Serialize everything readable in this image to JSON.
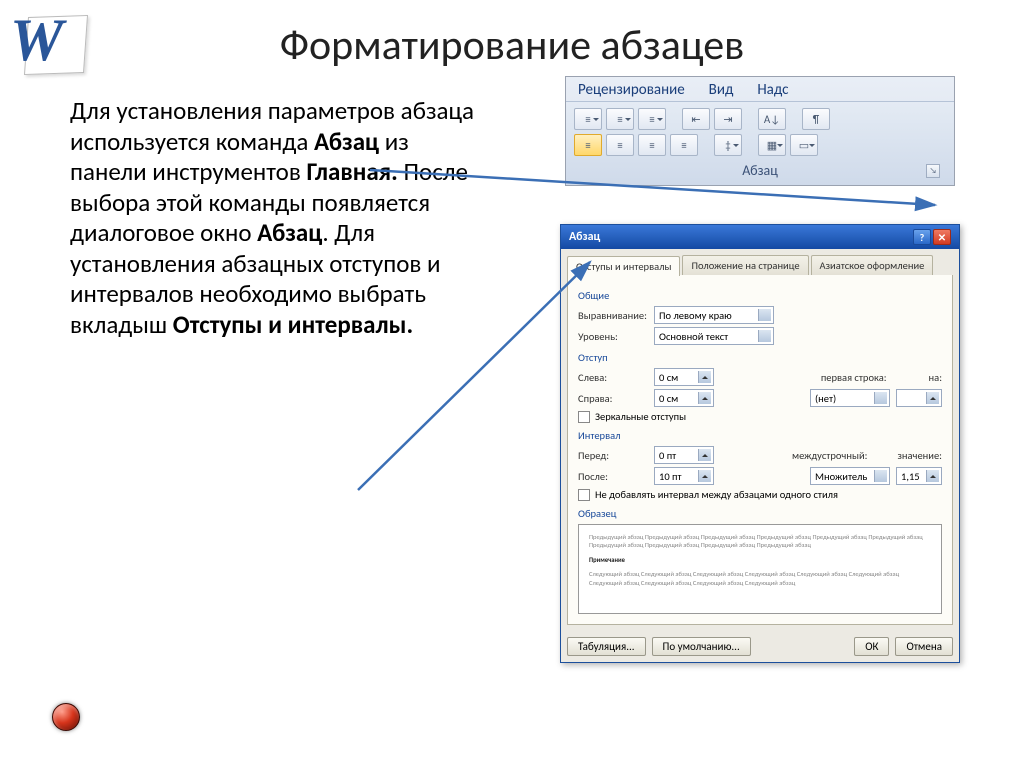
{
  "title": "Форматирование абзацев",
  "body_html": "Для установления параметров абзаца используется команда <b>Абзац</b> из панели инструментов <b>Главная.</b> После выбора этой команды появляется диалоговое окно <b>Абзац</b>. Для установления абзацных отступов и интервалов необходимо выбрать вкладыш <b>Отступы и интервалы.</b>",
  "ribbon": {
    "tabs": [
      "Рецензирование",
      "Вид",
      "Надс"
    ],
    "group_label": "Абзац"
  },
  "dialog": {
    "title": "Абзац",
    "tabs": [
      "Отступы и интервалы",
      "Положение на странице",
      "Азиатское оформление"
    ],
    "sections": {
      "general": "Общие",
      "align_label": "Выравнивание:",
      "align_value": "По левому краю",
      "level_label": "Уровень:",
      "level_value": "Основной текст",
      "indent": "Отступ",
      "left_label": "Слева:",
      "left_value": "0 см",
      "right_label": "Справа:",
      "right_value": "0 см",
      "firstline_label": "первая строка:",
      "firstline_value": "(нет)",
      "on_label": "на:",
      "on_value": "",
      "mirror": "Зеркальные отступы",
      "interval": "Интервал",
      "before_label": "Перед:",
      "before_value": "0 пт",
      "after_label": "После:",
      "after_value": "10 пт",
      "linespacing_label": "междустрочный:",
      "linespacing_value": "Множитель",
      "value_label": "значение:",
      "value_value": "1,15",
      "nosame": "Не добавлять интервал между абзацами одного стиля",
      "sample": "Образец"
    },
    "preview": {
      "light1": "Предыдущий абзац Предыдущий абзац Предыдущий абзац Предыдущий абзац Предыдущий абзац Предыдущий абзац Предыдущий абзац Предыдущий абзац Предыдущий абзац Предыдущий абзац",
      "dark": "Примечание",
      "light2": "Следующий абзац Следующий абзац Следующий абзац Следующий абзац Следующий абзац Следующий абзац Следующий абзац Следующий абзац Следующий абзац Следующий абзац"
    },
    "buttons": {
      "tabs": "Табуляция...",
      "default": "По умолчанию...",
      "ok": "ОК",
      "cancel": "Отмена"
    }
  }
}
